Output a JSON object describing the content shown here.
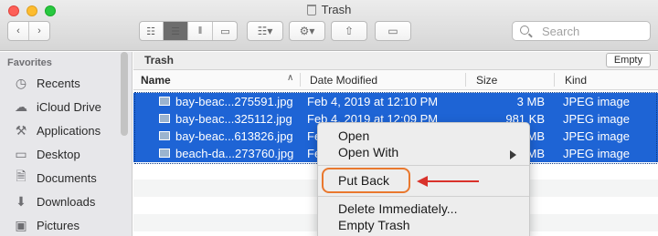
{
  "window": {
    "title": "Trash"
  },
  "toolbar": {
    "back_icon": "chevron-left-icon",
    "forward_icon": "chevron-right-icon",
    "search_placeholder": "Search"
  },
  "sidebar": {
    "heading": "Favorites",
    "items": [
      {
        "label": "Recents",
        "icon": "clock-icon"
      },
      {
        "label": "iCloud Drive",
        "icon": "cloud-icon"
      },
      {
        "label": "Applications",
        "icon": "applications-icon"
      },
      {
        "label": "Desktop",
        "icon": "desktop-icon"
      },
      {
        "label": "Documents",
        "icon": "document-icon"
      },
      {
        "label": "Downloads",
        "icon": "download-icon"
      },
      {
        "label": "Pictures",
        "icon": "camera-icon"
      }
    ]
  },
  "content": {
    "path_title": "Trash",
    "empty_button": "Empty",
    "columns": {
      "name": "Name",
      "date": "Date Modified",
      "size": "Size",
      "kind": "Kind"
    },
    "rows": [
      {
        "name": "bay-beac...275591.jpg",
        "date": "Feb 4, 2019 at 12:10 PM",
        "size": "3 MB",
        "kind": "JPEG image"
      },
      {
        "name": "bay-beac...325112.jpg",
        "date": "Feb 4, 2019 at 12:09 PM",
        "size": "981 KB",
        "kind": "JPEG image"
      },
      {
        "name": "bay-beac...613826.jpg",
        "date": "Fe",
        "size": "MB",
        "kind": "JPEG image"
      },
      {
        "name": "beach-da...273760.jpg",
        "date": "Fe",
        "size": "MB",
        "kind": "JPEG image"
      }
    ]
  },
  "context_menu": {
    "items": [
      "Open",
      "Open With",
      "Put Back",
      "Delete Immediately...",
      "Empty Trash"
    ],
    "highlighted": "Put Back"
  },
  "colors": {
    "selection": "#1e64d5",
    "annotation_box": "#e9782e",
    "annotation_arrow": "#d9322b"
  }
}
